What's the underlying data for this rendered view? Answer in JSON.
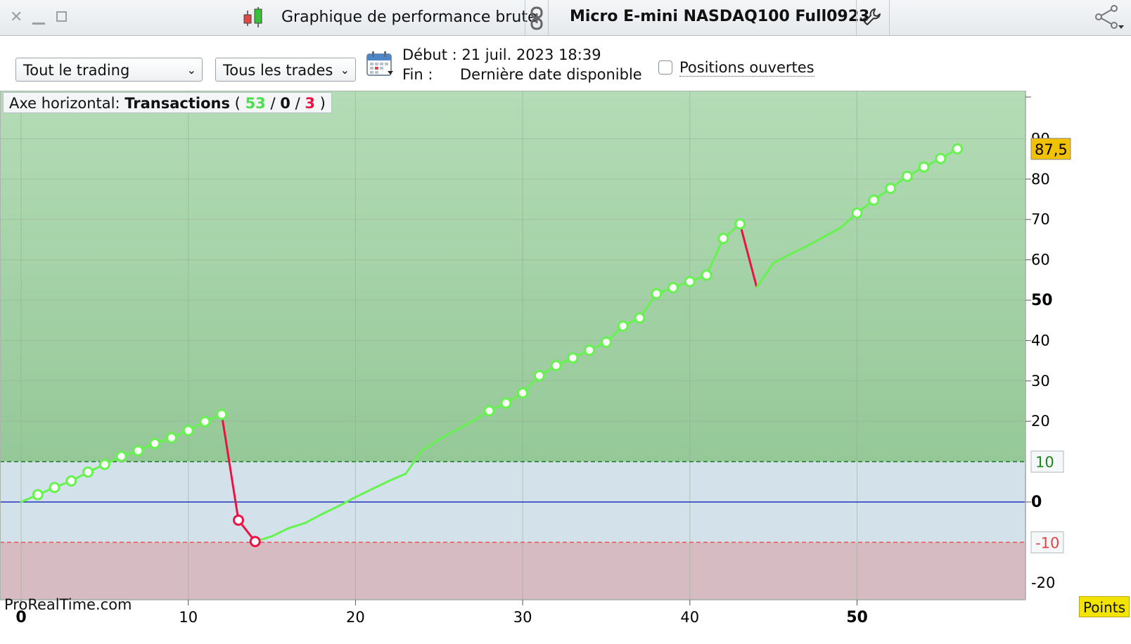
{
  "window": {
    "title": "Graphique de performance brute",
    "instrument": "Micro E-mini NASDAQ100 Full0923"
  },
  "toolbar": {
    "scope_select": "Tout le trading",
    "trades_select": "Tous les trades",
    "start_label": "Début : 21 juil. 2023 18:39",
    "end_label": "Fin :",
    "end_value": "Dernière date disponible",
    "open_positions_label": "Positions ouvertes",
    "open_positions_checked": false
  },
  "axis_badge": {
    "label": "Axe horizontal:",
    "mode": "Transactions",
    "open": "(",
    "wins": "53",
    "sep1": "/",
    "neutral": "0",
    "sep2": "/",
    "losses": "3",
    "close": ")"
  },
  "watermark": "ProRealTime.com",
  "units_badge": "Points",
  "colors": {
    "profit_zone": "#a6d6a9",
    "neutral_zone": "#d3e2ea",
    "loss_zone": "#d6bcc2",
    "win_line": "#66f24f",
    "loss_line": "#ee1144",
    "zero_line": "#2233bb",
    "last_value_bg": "#f2c200"
  },
  "chart_data": {
    "type": "line",
    "x_axis": "Transactions",
    "y_axis": "Points",
    "xlim": [
      0,
      60
    ],
    "ylim": [
      -20,
      92
    ],
    "x_ticks": [
      {
        "v": 0,
        "label": "0",
        "bold": true
      },
      {
        "v": 10,
        "label": "10",
        "bold": false
      },
      {
        "v": 20,
        "label": "20",
        "bold": false
      },
      {
        "v": 30,
        "label": "30",
        "bold": false
      },
      {
        "v": 40,
        "label": "40",
        "bold": false
      },
      {
        "v": 50,
        "label": "50",
        "bold": true
      }
    ],
    "y_ticks": [
      {
        "v": 80,
        "label": "80",
        "bold": false
      },
      {
        "v": 70,
        "label": "70",
        "bold": false
      },
      {
        "v": 60,
        "label": "60",
        "bold": false
      },
      {
        "v": 50,
        "label": "50",
        "bold": true
      },
      {
        "v": 40,
        "label": "40",
        "bold": false
      },
      {
        "v": 30,
        "label": "30",
        "bold": false
      },
      {
        "v": 20,
        "label": "20",
        "bold": false
      },
      {
        "v": 0,
        "label": "0",
        "bold": true
      }
    ],
    "threshold_high": {
      "v": 10,
      "label": "10"
    },
    "threshold_low": {
      "v": -10,
      "label": "-10"
    },
    "partial_labels": [
      {
        "v": 90,
        "label": "90"
      },
      {
        "v": -20,
        "label": "-20"
      }
    ],
    "last_value": {
      "v": 87.5,
      "label": "87,5"
    },
    "grid": true,
    "points": [
      {
        "x": 0,
        "y": 0,
        "m": false
      },
      {
        "x": 1,
        "y": 1.8,
        "m": true
      },
      {
        "x": 2,
        "y": 3.6,
        "m": true
      },
      {
        "x": 3,
        "y": 5.2,
        "m": true
      },
      {
        "x": 4,
        "y": 7.4,
        "m": true
      },
      {
        "x": 5,
        "y": 9.3,
        "m": true
      },
      {
        "x": 6,
        "y": 11.3,
        "m": true
      },
      {
        "x": 7,
        "y": 12.7,
        "m": true
      },
      {
        "x": 8,
        "y": 14.5,
        "m": true
      },
      {
        "x": 9,
        "y": 15.9,
        "m": true
      },
      {
        "x": 10,
        "y": 17.7,
        "m": true
      },
      {
        "x": 11,
        "y": 19.9,
        "m": true
      },
      {
        "x": 12,
        "y": 21.7,
        "m": true
      },
      {
        "x": 13,
        "y": -4.5,
        "m": true
      },
      {
        "x": 14,
        "y": -9.8,
        "m": true
      },
      {
        "x": 15,
        "y": -8.5,
        "m": false
      },
      {
        "x": 16,
        "y": -6.5,
        "m": false
      },
      {
        "x": 17,
        "y": -5.2,
        "m": false
      },
      {
        "x": 18,
        "y": -3.0,
        "m": false
      },
      {
        "x": 19,
        "y": -1.0,
        "m": false
      },
      {
        "x": 20,
        "y": 1.2,
        "m": false
      },
      {
        "x": 21,
        "y": 3.2,
        "m": false
      },
      {
        "x": 22,
        "y": 5.2,
        "m": false
      },
      {
        "x": 23,
        "y": 7.0,
        "m": false
      },
      {
        "x": 24,
        "y": 12.8,
        "m": false
      },
      {
        "x": 25,
        "y": 15.5,
        "m": false
      },
      {
        "x": 26,
        "y": 17.8,
        "m": false
      },
      {
        "x": 27,
        "y": 20.0,
        "m": false
      },
      {
        "x": 28,
        "y": 22.6,
        "m": true
      },
      {
        "x": 29,
        "y": 24.5,
        "m": true
      },
      {
        "x": 30,
        "y": 27.0,
        "m": true
      },
      {
        "x": 31,
        "y": 31.3,
        "m": true
      },
      {
        "x": 32,
        "y": 33.8,
        "m": true
      },
      {
        "x": 33,
        "y": 35.7,
        "m": true
      },
      {
        "x": 34,
        "y": 37.6,
        "m": true
      },
      {
        "x": 35,
        "y": 39.6,
        "m": true
      },
      {
        "x": 36,
        "y": 43.6,
        "m": true
      },
      {
        "x": 37,
        "y": 45.6,
        "m": true
      },
      {
        "x": 38,
        "y": 51.6,
        "m": true
      },
      {
        "x": 39,
        "y": 53.1,
        "m": true
      },
      {
        "x": 40,
        "y": 54.6,
        "m": true
      },
      {
        "x": 41,
        "y": 56.2,
        "m": true
      },
      {
        "x": 42,
        "y": 65.3,
        "m": true
      },
      {
        "x": 43,
        "y": 68.9,
        "m": true
      },
      {
        "x": 44,
        "y": 53.2,
        "m": false
      },
      {
        "x": 45,
        "y": 59.2,
        "m": false
      },
      {
        "x": 46,
        "y": 61.4,
        "m": false
      },
      {
        "x": 47,
        "y": 63.4,
        "m": false
      },
      {
        "x": 48,
        "y": 65.7,
        "m": false
      },
      {
        "x": 49,
        "y": 67.9,
        "m": false
      },
      {
        "x": 50,
        "y": 71.6,
        "m": true
      },
      {
        "x": 51,
        "y": 74.8,
        "m": true
      },
      {
        "x": 52,
        "y": 77.7,
        "m": true
      },
      {
        "x": 53,
        "y": 80.7,
        "m": true
      },
      {
        "x": 54,
        "y": 83.0,
        "m": true
      },
      {
        "x": 55,
        "y": 85.1,
        "m": true
      },
      {
        "x": 56,
        "y": 87.5,
        "m": true
      }
    ],
    "losing_trades": [
      13,
      14,
      44
    ]
  }
}
